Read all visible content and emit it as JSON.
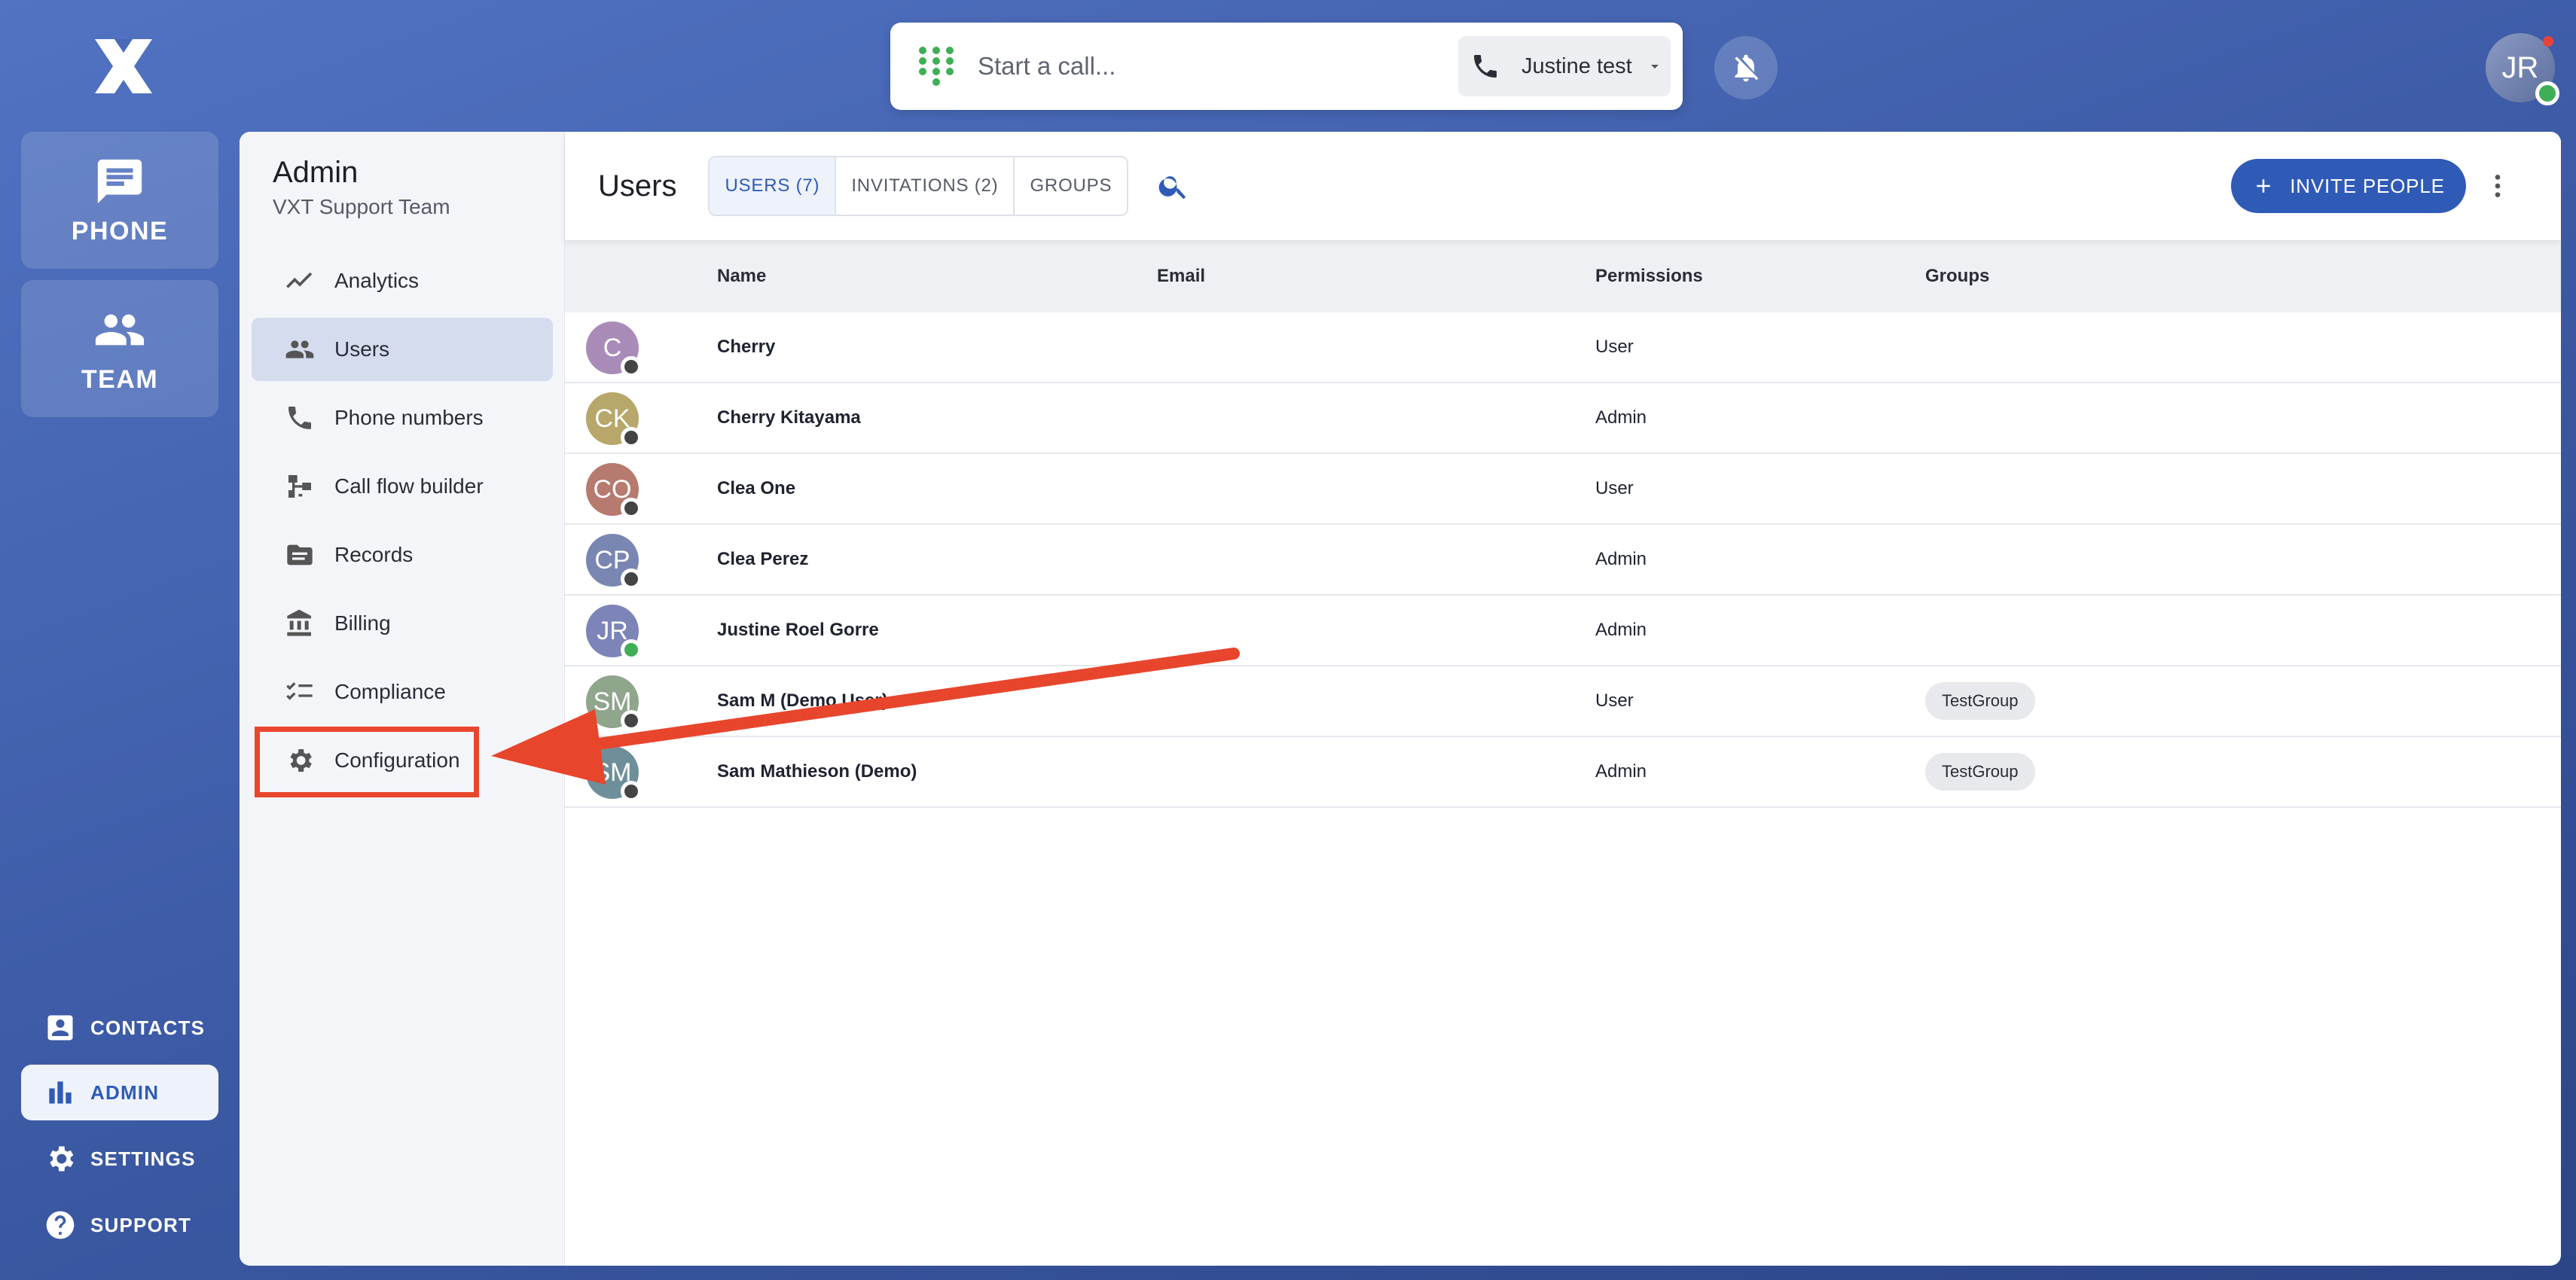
{
  "rail": {
    "phone_label": "PHONE",
    "team_label": "TEAM",
    "contacts_label": "CONTACTS",
    "admin_label": "ADMIN",
    "settings_label": "SETTINGS",
    "support_label": "SUPPORT"
  },
  "topbar": {
    "call_placeholder": "Start a call...",
    "line_label": "Justine test",
    "user_initials": "JR"
  },
  "admin": {
    "title": "Admin",
    "subtitle": "VXT Support Team",
    "nav": [
      {
        "label": "Analytics",
        "icon": "analytics-icon"
      },
      {
        "label": "Users",
        "icon": "users-icon"
      },
      {
        "label": "Phone numbers",
        "icon": "phone-icon"
      },
      {
        "label": "Call flow builder",
        "icon": "call-flow-icon"
      },
      {
        "label": "Records",
        "icon": "records-icon"
      },
      {
        "label": "Billing",
        "icon": "billing-icon"
      },
      {
        "label": "Compliance",
        "icon": "compliance-icon"
      },
      {
        "label": "Configuration",
        "icon": "gear-icon"
      }
    ]
  },
  "users": {
    "title": "Users",
    "tabs": [
      "USERS (7)",
      "INVITATIONS (2)",
      "GROUPS"
    ],
    "invite_label": "INVITE PEOPLE",
    "columns": {
      "name": "Name",
      "email": "Email",
      "permissions": "Permissions",
      "groups": "Groups"
    },
    "rows": [
      {
        "initials": "C",
        "name": "Cherry",
        "permission": "User",
        "group": "",
        "color": "#a98bb8",
        "online": false
      },
      {
        "initials": "CK",
        "name": "Cherry Kitayama",
        "permission": "Admin",
        "group": "",
        "color": "#b7a76a",
        "online": false
      },
      {
        "initials": "CO",
        "name": "Clea One",
        "permission": "User",
        "group": "",
        "color": "#b77a6f",
        "online": false
      },
      {
        "initials": "CP",
        "name": "Clea Perez",
        "permission": "Admin",
        "group": "",
        "color": "#7a86b2",
        "online": false
      },
      {
        "initials": "JR",
        "name": "Justine Roel Gorre",
        "permission": "Admin",
        "group": "",
        "color": "#7c84b8",
        "online": true
      },
      {
        "initials": "SM",
        "name": "Sam M (Demo User)",
        "permission": "User",
        "group": "TestGroup",
        "color": "#8fa58c",
        "online": false
      },
      {
        "initials": "SM",
        "name": "Sam Mathieson (Demo)",
        "permission": "Admin",
        "group": "TestGroup",
        "color": "#6e8f9a",
        "online": false
      }
    ]
  },
  "colors": {
    "accent": "#2f5bb7",
    "annotation": "#e8452d",
    "online": "#3fae56"
  }
}
